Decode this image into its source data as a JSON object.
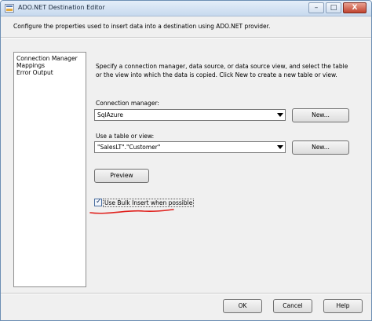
{
  "window": {
    "title": "ADO.NET Destination Editor",
    "controls": {
      "minimize": "–",
      "maximize": "□",
      "close": "X"
    }
  },
  "description": "Configure the properties used to insert data into a destination using ADO.NET provider.",
  "nav": {
    "items": [
      {
        "label": "Connection Manager"
      },
      {
        "label": "Mappings"
      },
      {
        "label": "Error Output"
      }
    ]
  },
  "main": {
    "instructions": "Specify a connection manager, data source, or data source view, and select the table or the view into which the data is copied. Click New to create a new table or view.",
    "connection_manager": {
      "label": "Connection manager:",
      "value": "SqlAzure",
      "new_button": "New..."
    },
    "table_or_view": {
      "label": "Use a table or view:",
      "value": "\"SalesLT\".\"Customer\"",
      "new_button": "New..."
    },
    "preview_button": "Preview",
    "bulk_insert": {
      "label": "Use Bulk Insert when possible",
      "checked": true,
      "check_glyph": "✓"
    }
  },
  "footer": {
    "ok": "OK",
    "cancel": "Cancel",
    "help": "Help"
  },
  "colors": {
    "annotation_underline": "#e0201c",
    "dialog_background": "#f0f0f0"
  }
}
